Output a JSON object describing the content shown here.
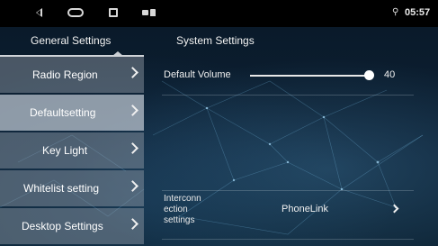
{
  "statusbar": {
    "time": "05:57",
    "location_glyph": "⚲",
    "icons": [
      "back-icon",
      "home-icon",
      "recent-apps-icon",
      "image-notification-icon",
      "lock-notification-icon",
      "location-icon"
    ]
  },
  "tabs": [
    {
      "label": "General Settings",
      "active": true
    },
    {
      "label": "System Settings",
      "active": false
    }
  ],
  "sidebar": {
    "items": [
      {
        "label": "Radio Region",
        "active": false
      },
      {
        "label": "Defaultsetting",
        "active": true
      },
      {
        "label": "Key Light",
        "active": false
      },
      {
        "label": "Whitelist setting",
        "active": false
      },
      {
        "label": "Desktop Settings",
        "active": false
      }
    ]
  },
  "content": {
    "default_volume": {
      "label": "Default Volume",
      "value": "40",
      "level": 0.4
    },
    "interconnection": {
      "label_lines": [
        "Interconn",
        "ection",
        "settings"
      ],
      "value": "PhoneLink"
    }
  },
  "colors": {
    "sidebar_active": "#b9c3cd",
    "sidebar_inactive": "#96a0aa",
    "background": "#0d2236"
  }
}
